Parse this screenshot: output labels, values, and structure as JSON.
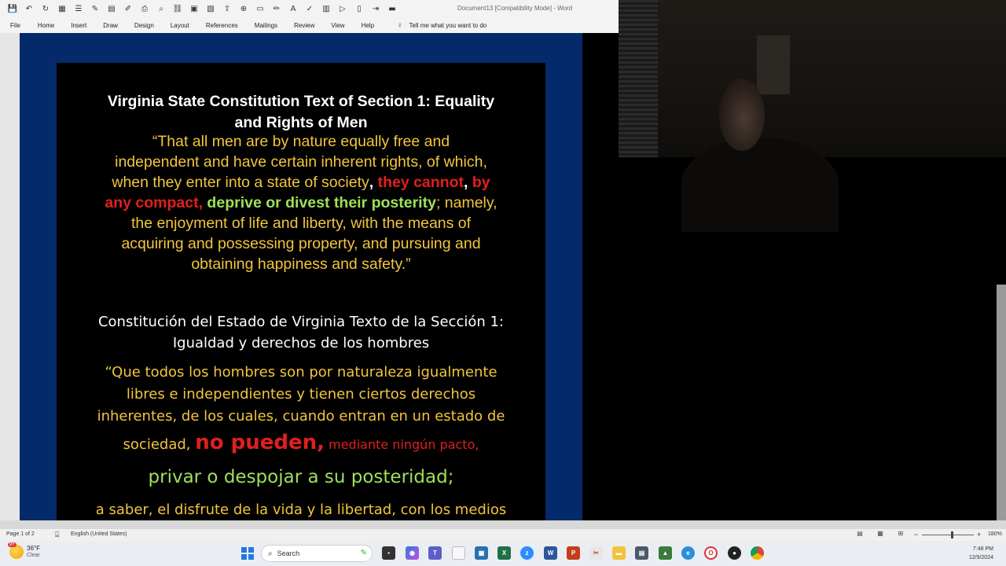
{
  "word": {
    "document_title": "Document13 [Compatibility Mode] - Word",
    "menus": [
      "File",
      "Home",
      "Insert",
      "Draw",
      "Design",
      "Layout",
      "References",
      "Mailings",
      "Review",
      "View",
      "Help"
    ],
    "tell_me": "Tell me what you want to do"
  },
  "slide": {
    "en_title_line1": "Virginia State Constitution Text of Section 1: Equality",
    "en_title_line2": "and Rights of Men",
    "en_line1": "“That all men are by nature equally free and",
    "en_line2": "independent and have certain inherent rights, of which,",
    "en_line3a": "when they enter into a state of society",
    "en_line3b": ",",
    "en_line3c": " they cannot",
    "en_line3d": ", ",
    "en_line3e": "by",
    "en_line4a": "any compact,",
    "en_line4b": " deprive or divest their posterity",
    "en_line4c": "; namely,",
    "en_line5": "the enjoyment of life and liberty, with the means of",
    "en_line6": "acquiring and possessing property, and pursuing and",
    "en_line7": "obtaining happiness and safety.”",
    "es_title_line1": "Constitución del Estado de Virginia Texto de la Sección 1:",
    "es_title_line2": "Igualdad y derechos de los hombres",
    "es_line1": "“Que todos los hombres son por naturaleza igualmente",
    "es_line2": "libres e independientes y tienen ciertos derechos",
    "es_line3": "inherentes, de los cuales, cuando entran en un estado de",
    "es_line4a": "sociedad, ",
    "es_line4b": "no pueden,",
    "es_line4c": " mediante ningún pacto,",
    "es_line5": "privar o despojar a su posteridad;",
    "es_line6": "a saber, el disfrute de la vida y la libertad, con los medios"
  },
  "status": {
    "page": "Page 1 of 2",
    "language": "English (United States)",
    "zoom": "180%",
    "zoom_minus": "−",
    "zoom_plus": "+"
  },
  "taskbar": {
    "weather_badge": "9+",
    "weather_temp": "36°F",
    "weather_cond": "Clear",
    "search_placeholder": "Search",
    "time": "7:48 PM",
    "date": "12/9/2024"
  }
}
